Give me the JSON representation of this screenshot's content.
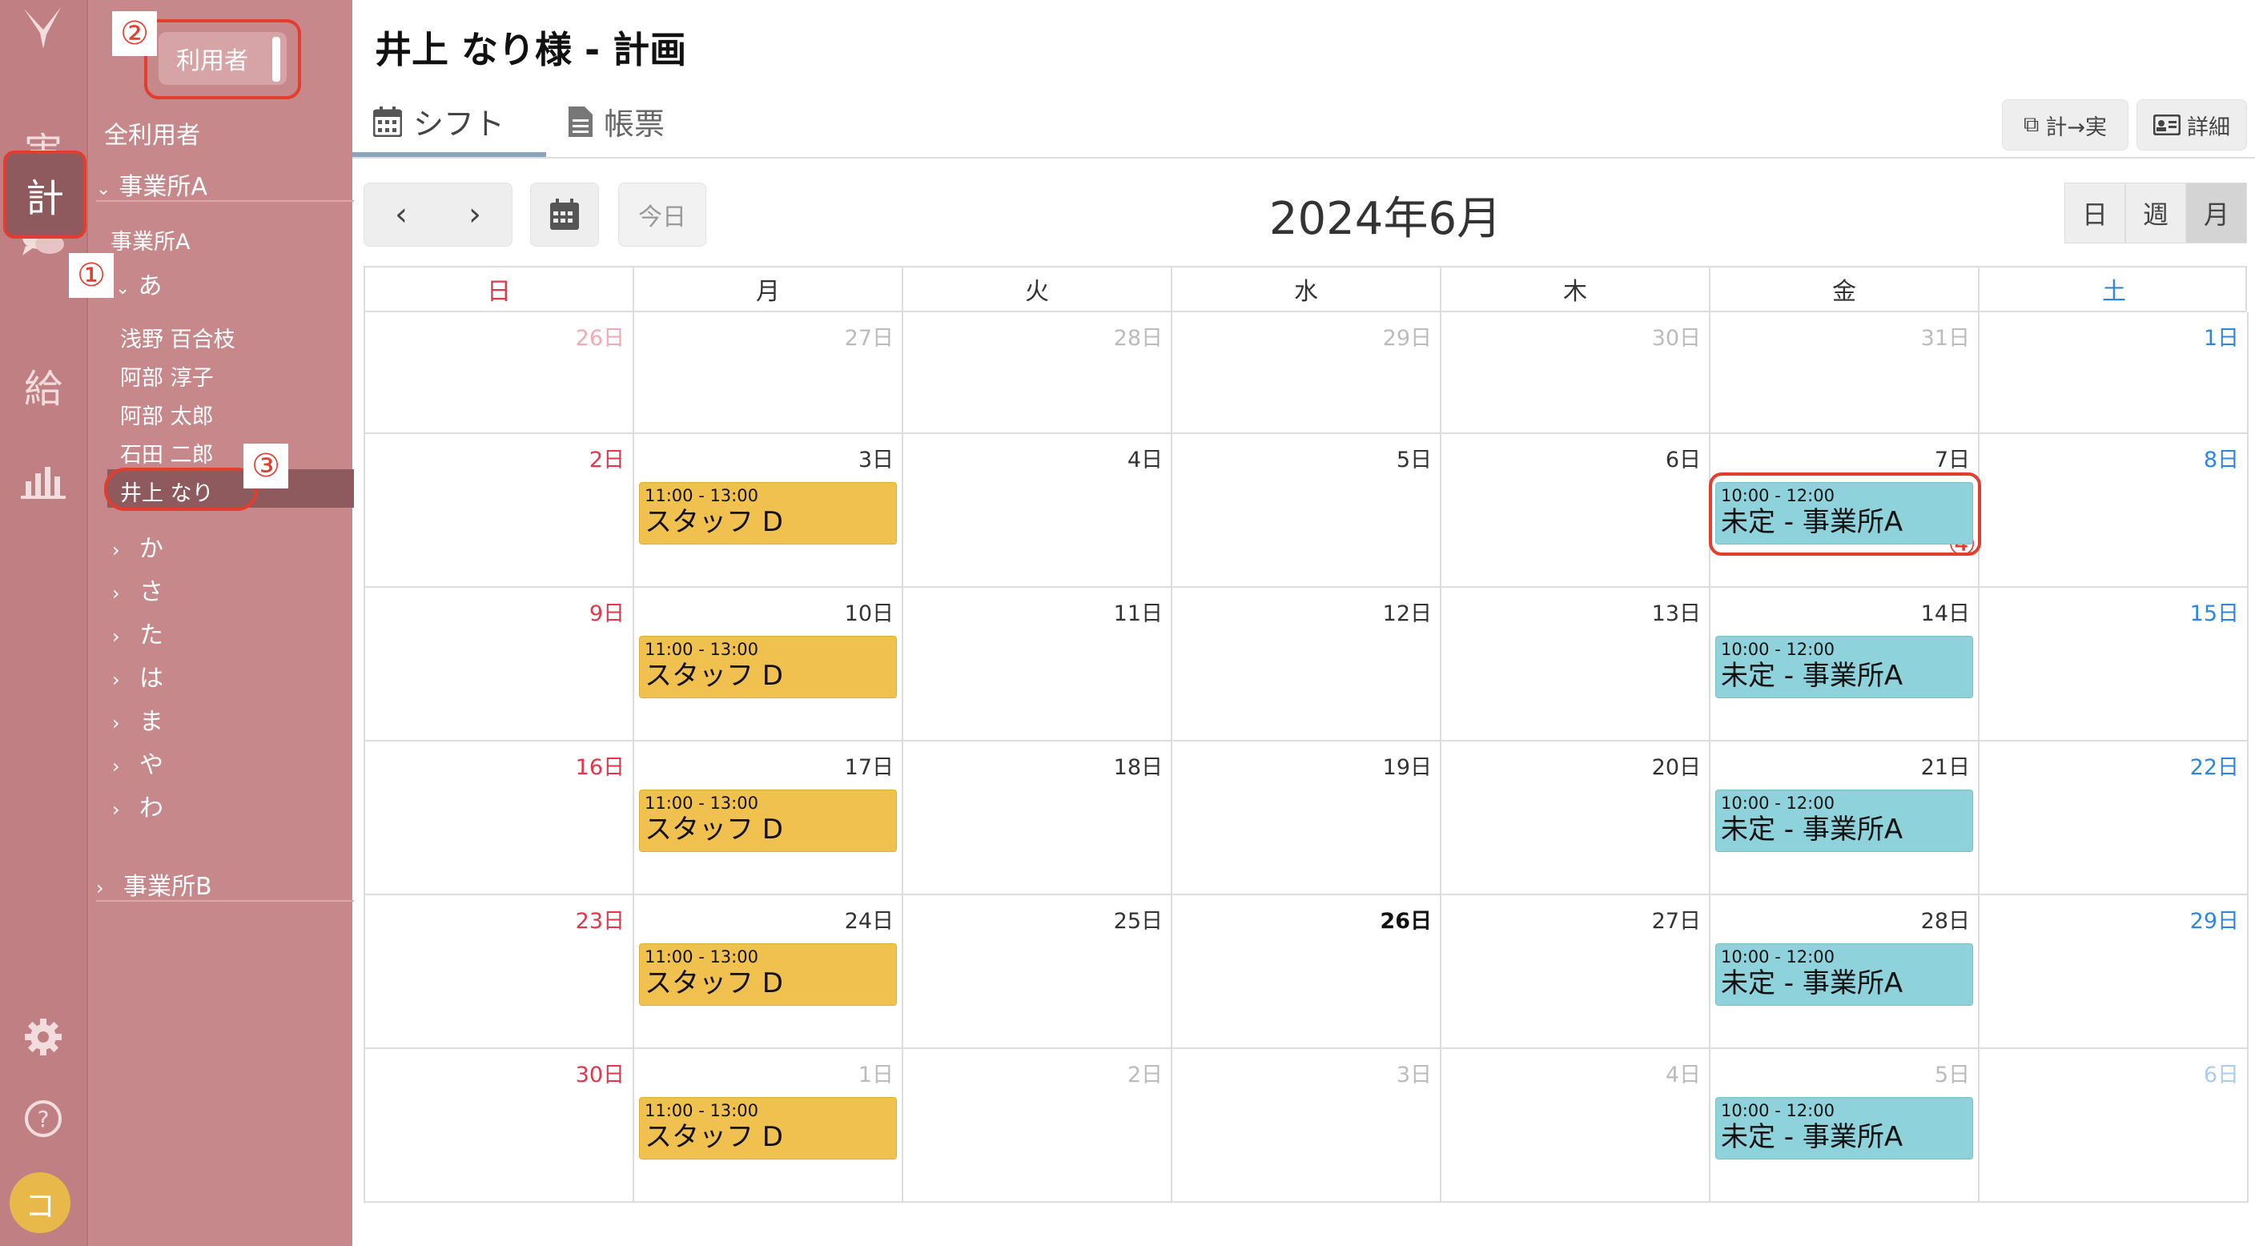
{
  "rail": {
    "items": [
      {
        "label": "実",
        "name": "rail-actual"
      },
      {
        "label": "計",
        "name": "rail-plan"
      },
      {
        "label": "給",
        "name": "rail-pay"
      }
    ],
    "avatar": "コ"
  },
  "sidebar": {
    "toggle_label": "利用者",
    "all_users": "全利用者",
    "office_a_header": "事業所A",
    "office_a_label": "事業所A",
    "group_a": "あ",
    "users": [
      "浅野 百合枝",
      "阿部 淳子",
      "阿部 太郎",
      "石田 二郎",
      "井上 なり"
    ],
    "kana_groups": [
      "か",
      "さ",
      "た",
      "は",
      "ま",
      "や",
      "わ"
    ],
    "office_b_header": "事業所B",
    "badges": [
      "①",
      "②",
      "③",
      "④"
    ]
  },
  "header": {
    "title": "井上 なり様 - 計画",
    "tabs": [
      {
        "label": "シフト"
      },
      {
        "label": "帳票"
      }
    ],
    "btn_copy": "計→実",
    "btn_detail": "詳細"
  },
  "toolbar": {
    "today": "今日",
    "month_title": "2024年6月",
    "views": [
      "日",
      "週",
      "月"
    ]
  },
  "calendar": {
    "weekdays": [
      "日",
      "月",
      "火",
      "水",
      "木",
      "金",
      "土"
    ],
    "weeks": [
      [
        "26日",
        "27日",
        "28日",
        "29日",
        "30日",
        "31日",
        "1日"
      ],
      [
        "2日",
        "3日",
        "4日",
        "5日",
        "6日",
        "7日",
        "8日"
      ],
      [
        "9日",
        "10日",
        "11日",
        "12日",
        "13日",
        "14日",
        "15日"
      ],
      [
        "16日",
        "17日",
        "18日",
        "19日",
        "20日",
        "21日",
        "22日"
      ],
      [
        "23日",
        "24日",
        "25日",
        "26日",
        "27日",
        "28日",
        "29日"
      ],
      [
        "30日",
        "1日",
        "2日",
        "3日",
        "4日",
        "5日",
        "6日"
      ]
    ],
    "events": {
      "staff": {
        "time": "11:00 - 13:00",
        "label": "スタッフ D"
      },
      "office": {
        "time": "10:00 - 12:00",
        "label": "未定 - 事業所A"
      }
    }
  },
  "colors": {
    "rail": "#c07f82",
    "sidebar": "#c6888b",
    "staff_event": "#f1c14f",
    "office_event": "#8ed3dc",
    "highlight": "#e23d2e",
    "sunday": "#e0374b",
    "saturday": "#2f86de"
  }
}
